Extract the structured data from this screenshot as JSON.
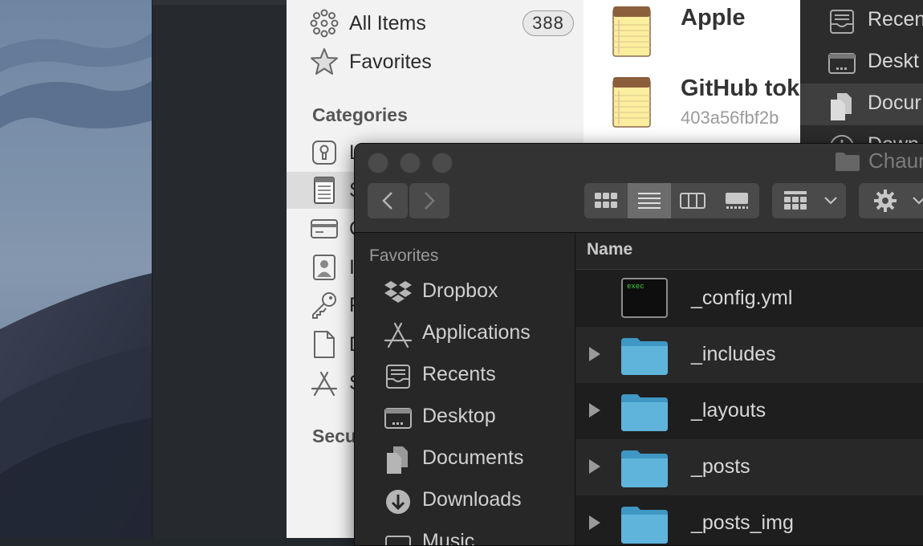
{
  "onepassword": {
    "nav": [
      {
        "label": "All Items",
        "count": "388",
        "icon": "all-items-icon"
      },
      {
        "label": "Favorites",
        "icon": "star-icon"
      }
    ],
    "categories_heading": "Categories",
    "categories": [
      {
        "label": "L",
        "icon": "keyhole-icon"
      },
      {
        "label": "S",
        "icon": "secure-note-icon",
        "selected": true
      },
      {
        "label": "C",
        "icon": "credit-card-icon"
      },
      {
        "label": "I",
        "icon": "identity-icon"
      },
      {
        "label": "P",
        "icon": "key-icon"
      },
      {
        "label": "D",
        "icon": "document-icon"
      },
      {
        "label": "S",
        "icon": "app-store-icon"
      }
    ],
    "security_heading": "Secu",
    "items": [
      {
        "title": "Apple",
        "subtitle": ""
      },
      {
        "title": "GitHub tok",
        "subtitle": "403a56fbf2b"
      }
    ]
  },
  "back_finder": {
    "items": [
      {
        "label": "Recen",
        "icon": "recents-icon"
      },
      {
        "label": "Deskt",
        "icon": "desktop-icon"
      },
      {
        "label": "Docur",
        "icon": "documents-icon",
        "selected": true
      },
      {
        "label": "Down",
        "icon": "downloads-icon"
      }
    ]
  },
  "finder": {
    "title": "Chaur",
    "sidebar_heading": "Favorites",
    "sidebar": [
      {
        "label": "Dropbox",
        "icon": "dropbox-icon"
      },
      {
        "label": "Applications",
        "icon": "applications-icon"
      },
      {
        "label": "Recents",
        "icon": "recents-icon"
      },
      {
        "label": "Desktop",
        "icon": "desktop-icon"
      },
      {
        "label": "Documents",
        "icon": "documents-icon"
      },
      {
        "label": "Downloads",
        "icon": "downloads-icon"
      },
      {
        "label": "Music",
        "icon": "music-icon"
      }
    ],
    "column_name": "Name",
    "files": [
      {
        "name": "_config.yml",
        "kind": "exec",
        "exec_label": "exec",
        "expandable": false
      },
      {
        "name": "_includes",
        "kind": "folder",
        "expandable": true
      },
      {
        "name": "_layouts",
        "kind": "folder",
        "expandable": true
      },
      {
        "name": "_posts",
        "kind": "folder",
        "expandable": true
      },
      {
        "name": "_posts_img",
        "kind": "folder",
        "expandable": true
      }
    ]
  },
  "colors": {
    "folder": "#5fb4dc",
    "exec_text": "#3bd23b",
    "notepad": "#fbee9e"
  }
}
